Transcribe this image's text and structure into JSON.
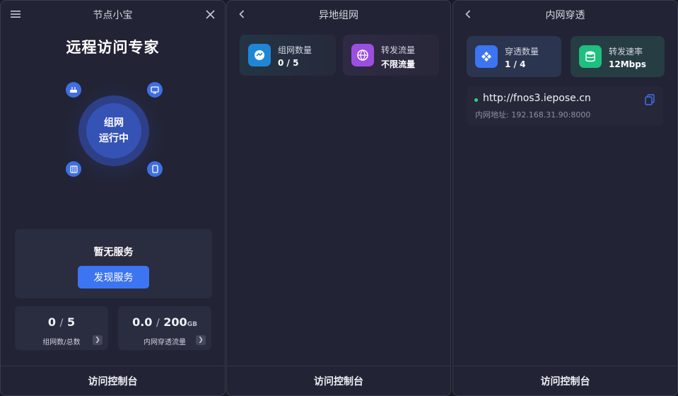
{
  "panel1": {
    "title": "节点小宝",
    "hero_title": "远程访问专家",
    "status_line1": "组网",
    "status_line2": "运行中",
    "service_empty": "暂无服务",
    "discover_button": "发现服务",
    "stat_network": {
      "value": "0",
      "total": "5",
      "label": "组网数/总数"
    },
    "stat_traffic": {
      "value": "0.0",
      "total": "200",
      "unit": "GB",
      "label": "内网穿透流量"
    },
    "footer": "访问控制台"
  },
  "panel2": {
    "title": "异地组网",
    "cards": [
      {
        "label": "组网数量",
        "value": "0 / 5",
        "icon": "network-icon",
        "color": "#1f86d6"
      },
      {
        "label": "转发流量",
        "value": "不限流量",
        "icon": "globe-icon",
        "color": "#9b4fe0"
      }
    ],
    "footer": "访问控制台"
  },
  "panel3": {
    "title": "内网穿透",
    "cards": [
      {
        "label": "穿透数量",
        "value": "1 / 4",
        "icon": "tunnel-icon",
        "color": "#3d74f2"
      },
      {
        "label": "转发速率",
        "value": "12Mbps",
        "icon": "database-icon",
        "color": "#1fbf7f"
      }
    ],
    "url": "http://fnos3.iepose.cn",
    "url_sub": "内网地址: 192.168.31.90:8000",
    "footer": "访问控制台"
  },
  "colors": {
    "accent": "#3d74f2",
    "panel_bg": "#222334",
    "card_bg": "#2a2c3f",
    "online": "#2fd28a"
  }
}
